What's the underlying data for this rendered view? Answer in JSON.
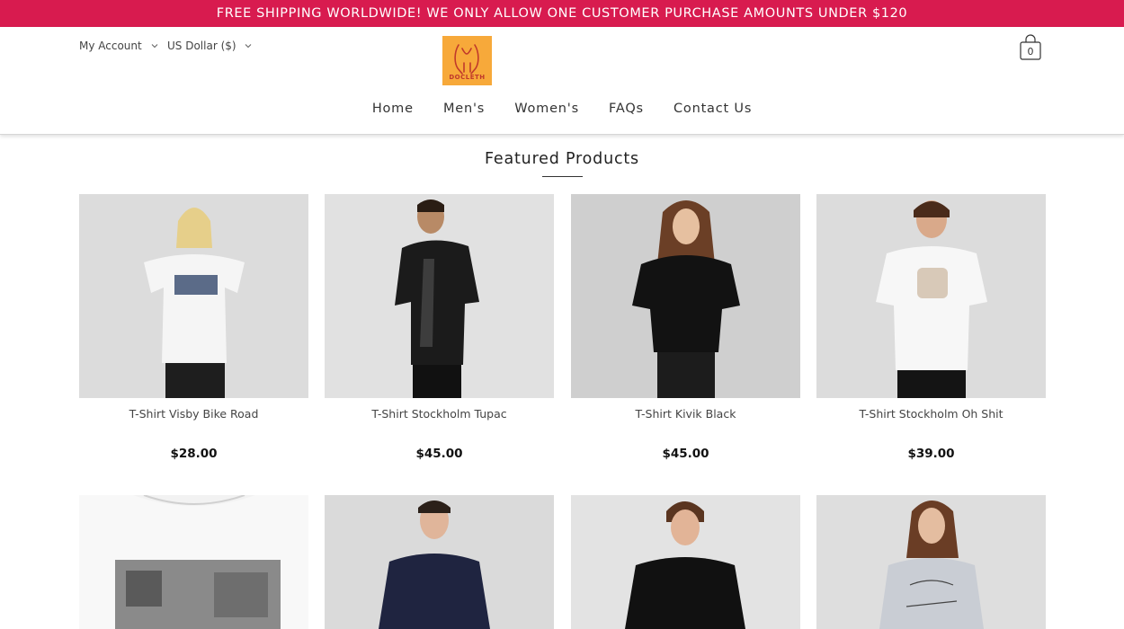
{
  "announcement": "FREE SHIPPING WORLDWIDE! WE ONLY ALLOW ONE CUSTOMER PURCHASE AMOUNTS UNDER $120",
  "header": {
    "account_label": "My Account",
    "currency_label": "US Dollar ($)",
    "logo_text": "DOCLETH",
    "cart_count": "0"
  },
  "nav": [
    "Home",
    "Men's",
    "Women's",
    "FAQs",
    "Contact Us"
  ],
  "section_title": "Featured Products",
  "products": [
    {
      "name": "T-Shirt Visby Bike Road",
      "price": "$28.00"
    },
    {
      "name": "T-Shirt Stockholm Tupac",
      "price": "$45.00"
    },
    {
      "name": "T-Shirt Kivik Black",
      "price": "$45.00"
    },
    {
      "name": "T-Shirt Stockholm Oh Shit",
      "price": "$39.00"
    },
    {
      "name": "",
      "price": ""
    },
    {
      "name": "",
      "price": ""
    },
    {
      "name": "",
      "price": ""
    },
    {
      "name": "",
      "price": ""
    }
  ],
  "colors": {
    "announcement_bg": "#d81b4f",
    "logo_bg": "#f7a93a"
  }
}
